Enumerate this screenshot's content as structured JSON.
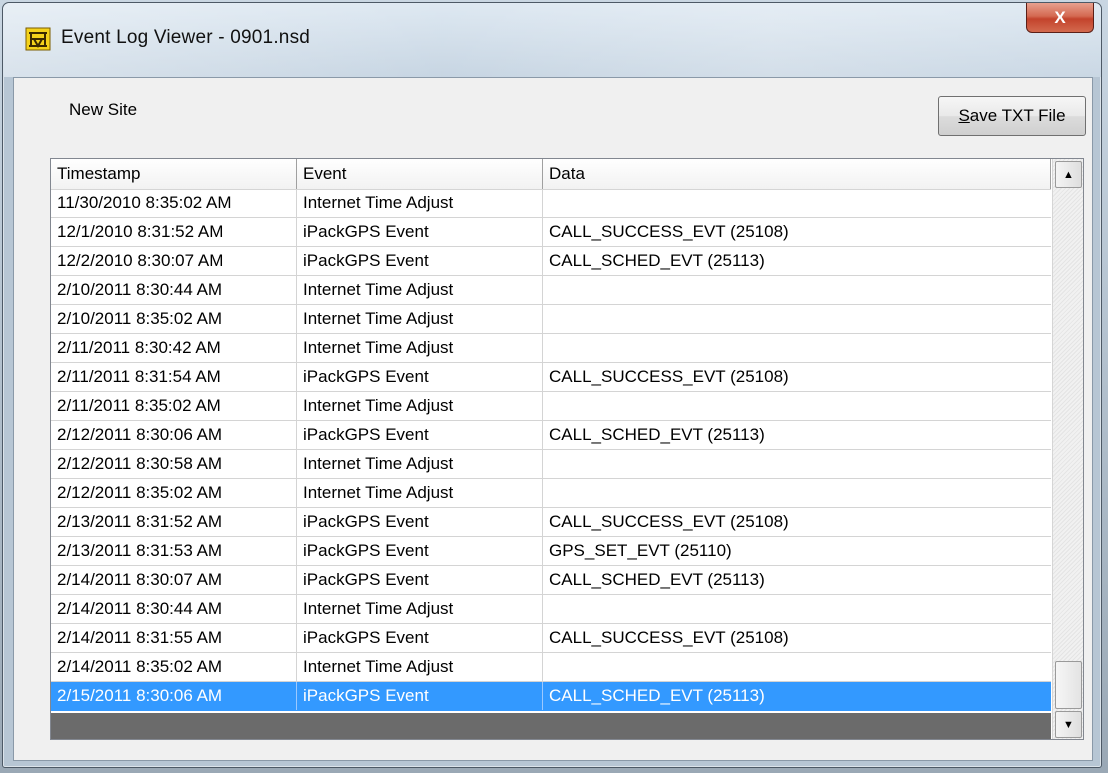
{
  "window": {
    "title": "Event Log Viewer - 0901.nsd",
    "icon": "yellow-chain-icon",
    "close_label": "X"
  },
  "header_area": {
    "site_name": "New Site",
    "save_button": {
      "prefix": "S",
      "rest": "ave TXT File"
    }
  },
  "table": {
    "columns": [
      "Timestamp",
      "Event",
      "Data"
    ],
    "rows": [
      [
        "11/30/2010 8:35:02 AM",
        "Internet Time Adjust",
        ""
      ],
      [
        "12/1/2010 8:31:52 AM",
        "iPackGPS Event",
        "CALL_SUCCESS_EVT (25108)"
      ],
      [
        "12/2/2010 8:30:07 AM",
        "iPackGPS Event",
        "CALL_SCHED_EVT (25113)"
      ],
      [
        "2/10/2011 8:30:44 AM",
        "Internet Time Adjust",
        ""
      ],
      [
        "2/10/2011 8:35:02 AM",
        "Internet Time Adjust",
        ""
      ],
      [
        "2/11/2011 8:30:42 AM",
        "Internet Time Adjust",
        ""
      ],
      [
        "2/11/2011 8:31:54 AM",
        "iPackGPS Event",
        "CALL_SUCCESS_EVT (25108)"
      ],
      [
        "2/11/2011 8:35:02 AM",
        "Internet Time Adjust",
        ""
      ],
      [
        "2/12/2011 8:30:06 AM",
        "iPackGPS Event",
        "CALL_SCHED_EVT (25113)"
      ],
      [
        "2/12/2011 8:30:58 AM",
        "Internet Time Adjust",
        ""
      ],
      [
        "2/12/2011 8:35:02 AM",
        "Internet Time Adjust",
        ""
      ],
      [
        "2/13/2011 8:31:52 AM",
        "iPackGPS Event",
        "CALL_SUCCESS_EVT (25108)"
      ],
      [
        "2/13/2011 8:31:53 AM",
        "iPackGPS Event",
        "GPS_SET_EVT (25110)"
      ],
      [
        "2/14/2011 8:30:07 AM",
        "iPackGPS Event",
        "CALL_SCHED_EVT (25113)"
      ],
      [
        "2/14/2011 8:30:44 AM",
        "Internet Time Adjust",
        ""
      ],
      [
        "2/14/2011 8:31:55 AM",
        "iPackGPS Event",
        "CALL_SUCCESS_EVT (25108)"
      ],
      [
        "2/14/2011 8:35:02 AM",
        "Internet Time Adjust",
        ""
      ],
      [
        "2/15/2011 8:30:06 AM",
        "iPackGPS Event",
        "CALL_SCHED_EVT (25113)"
      ]
    ],
    "selected_row_index": 17,
    "selection_color": "#3399ff"
  },
  "scrollbar": {
    "up_icon": "arrow-up-icon",
    "down_icon": "arrow-down-icon",
    "position": "bottom"
  }
}
